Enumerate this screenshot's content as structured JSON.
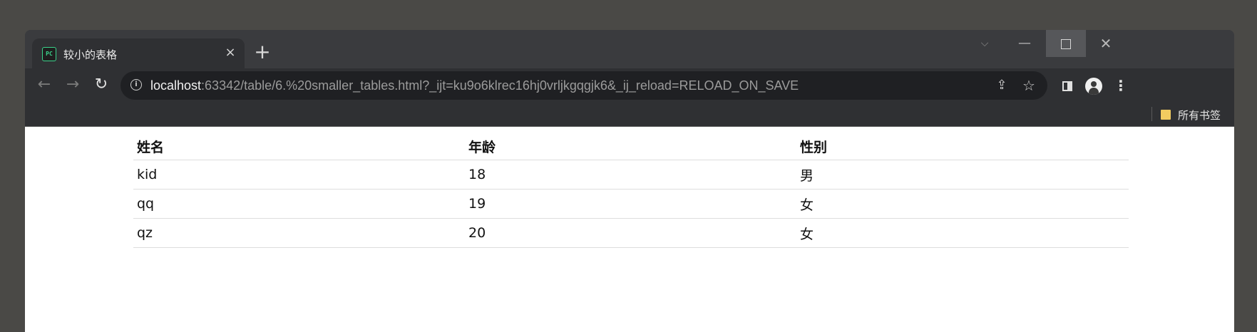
{
  "window": {
    "tab": {
      "title": "较小的表格",
      "favicon": "pycharm-icon",
      "close_glyph": "×"
    },
    "newtab_glyph": "+",
    "controls": {
      "tabsearch": "⌵",
      "minimize": "—",
      "close": "✕"
    }
  },
  "toolbar": {
    "back_glyph": "←",
    "forward_glyph": "→",
    "reload_glyph": "↻",
    "url_host": "localhost",
    "url_rest": ":63342/table/6.%20smaller_tables.html?_ijt=ku9o6klrec16hj0vrljkgqgjk6&_ij_reload=RELOAD_ON_SAVE",
    "share_glyph": "⇪",
    "star_glyph": "☆",
    "menu_glyph": "⋮"
  },
  "bookmarks": {
    "all_bookmarks_label": "所有书签"
  },
  "table": {
    "headers": [
      "姓名",
      "年龄",
      "性别"
    ],
    "rows": [
      [
        "kid",
        "18",
        "男"
      ],
      [
        "qq",
        "19",
        "女"
      ],
      [
        "qz",
        "20",
        "女"
      ]
    ]
  },
  "colors": {
    "tab_active": "#2f3033",
    "window_bg": "#3a3b3e",
    "folder": "#f2cc60"
  }
}
